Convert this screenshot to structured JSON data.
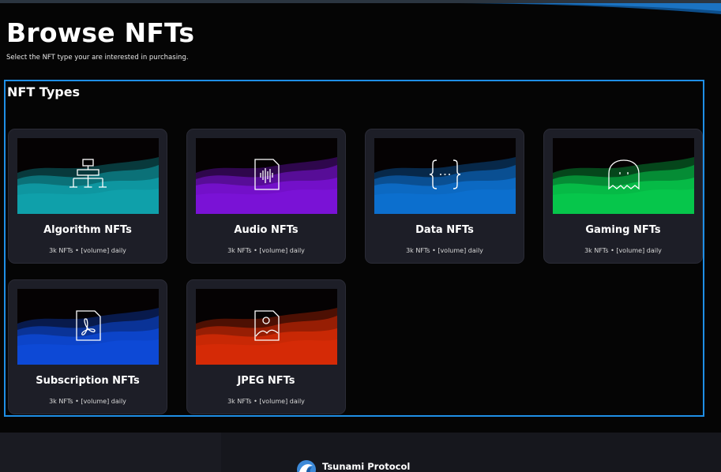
{
  "header": {
    "title": "Browse NFTs",
    "subtitle": "Select the NFT type your are interested in purchasing."
  },
  "section": {
    "title": "NFT Types"
  },
  "cards": [
    {
      "title": "Algorithm NFTs",
      "stats": "3k NFTs • [volume] daily",
      "color": "#0fa0aa",
      "icon": "hierarchy-icon"
    },
    {
      "title": "Audio NFTs",
      "stats": "3k NFTs • [volume] daily",
      "color": "#7a12d6",
      "icon": "audio-file-icon"
    },
    {
      "title": "Data NFTs",
      "stats": "3k NFTs • [volume] daily",
      "color": "#0c6fce",
      "icon": "code-braces-icon"
    },
    {
      "title": "Gaming NFTs",
      "stats": "3k NFTs • [volume] daily",
      "color": "#06c64b",
      "icon": "ghost-icon"
    },
    {
      "title": "Subscription NFTs",
      "stats": "3k NFTs • [volume] daily",
      "color": "#0d49d6",
      "icon": "pdf-file-icon"
    },
    {
      "title": "JPEG NFTs",
      "stats": "3k NFTs • [volume] daily",
      "color": "#d52a06",
      "icon": "image-file-icon"
    }
  ],
  "footer": {
    "brand": "Tsunami Protocol",
    "logo_icon": "tsunami-logo-icon"
  }
}
